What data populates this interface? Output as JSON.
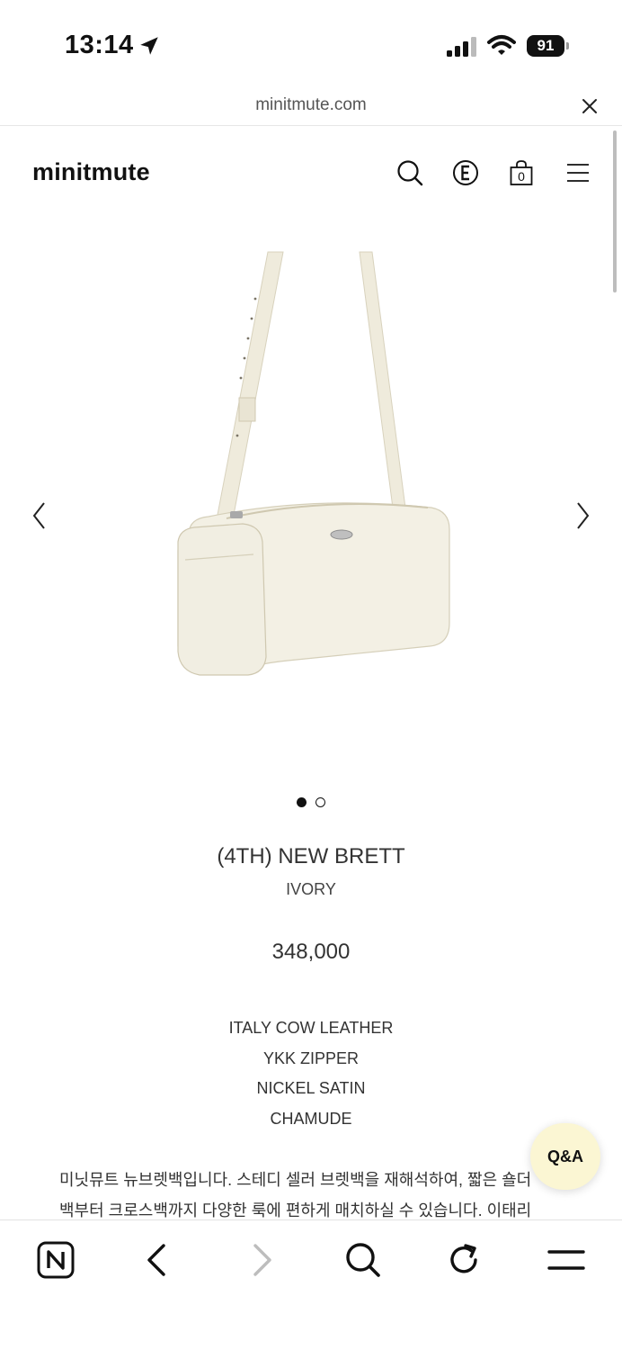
{
  "status_bar": {
    "time": "13:14",
    "battery": "91",
    "icons": [
      "location-arrow-icon",
      "signal-icon",
      "wifi-icon",
      "battery-icon"
    ]
  },
  "browser": {
    "url": "minitmute.com",
    "close_icon": "close-icon"
  },
  "header": {
    "logo": "minitmute",
    "icons": [
      "search-icon",
      "currency-e-icon",
      "shopping-bag-icon",
      "menu-icon"
    ],
    "cart_count": "0"
  },
  "gallery": {
    "prev_icon": "chevron-left-icon",
    "next_icon": "chevron-right-icon",
    "image_colour": "#f3f0e4",
    "page_count": 2,
    "current_page": 1
  },
  "product": {
    "name": "(4TH) NEW BRETT",
    "color": "IVORY",
    "price": "348,000",
    "specs": [
      "ITALY COW LEATHER",
      "YKK ZIPPER",
      "NICKEL SATIN",
      "CHAMUDE"
    ],
    "description_lines": [
      "미닛뮤트 뉴브렛백입니다. 스테디 셀러 브렛백을 재해석하여, 짧은 숄더",
      "백부터 크로스백까지 다양한 룩에 편하게 매치하실 수 있습니다. 이태리"
    ]
  },
  "qa": {
    "label": "Q&A",
    "color": "#fbf6d3"
  },
  "toolbar": {
    "icons": [
      "naver-n-icon",
      "back-icon",
      "forward-icon",
      "search-icon",
      "reload-icon",
      "menu-icon"
    ]
  }
}
